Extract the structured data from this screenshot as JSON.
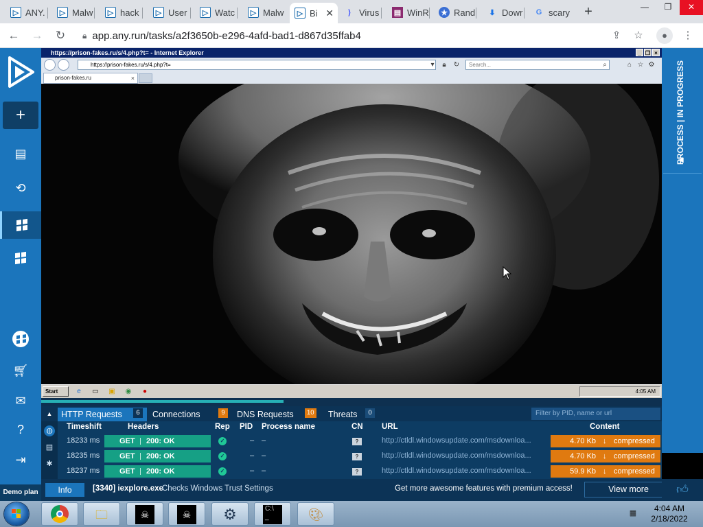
{
  "browser": {
    "tabs": [
      {
        "title": "ANY.",
        "icon": "anyrun-icon"
      },
      {
        "title": "Malw",
        "icon": "anyrun-icon"
      },
      {
        "title": "hack",
        "icon": "anyrun-icon"
      },
      {
        "title": "User",
        "icon": "anyrun-icon"
      },
      {
        "title": "Watc",
        "icon": "anyrun-icon"
      },
      {
        "title": "Malw",
        "icon": "anyrun-icon"
      },
      {
        "title": "Bi",
        "icon": "anyrun-icon",
        "close": "✕"
      },
      {
        "title": "Virus",
        "icon": "virustotal-icon"
      },
      {
        "title": "WinR",
        "icon": "winrar-icon"
      },
      {
        "title": "Rand",
        "icon": "random-icon"
      },
      {
        "title": "Dowr",
        "icon": "download-icon"
      },
      {
        "title": "scary",
        "icon": "google-icon"
      }
    ],
    "new_tab": "+",
    "address": "app.any.run/tasks/a2f3650b-e296-4afd-bad1-d867d35ffab4",
    "window_buttons": {
      "minimize": "—",
      "restore": "❐",
      "close": "✕"
    }
  },
  "sidebar": {
    "demo_label": "Demo plan"
  },
  "right_strip": {
    "status": "PROCESS | IN PROGRESS"
  },
  "vm": {
    "ie_title": "https://prison-fakes.ru/s/4.php?t= - Internet Explorer",
    "ie_address": "https://prison-fakes.ru/s/4.php?t=",
    "ie_search_placeholder": "Search...",
    "ie_tab": "prison-fakes.ru",
    "xp_start": "Start",
    "xp_clock": "4:05 AM"
  },
  "progress": {
    "value": 0.39
  },
  "panel": {
    "tabs": [
      {
        "label": "HTTP Requests",
        "count": "6"
      },
      {
        "label": "Connections",
        "count": "9"
      },
      {
        "label": "DNS Requests",
        "count": "10"
      },
      {
        "label": "Threats",
        "count": "0"
      }
    ],
    "filter_placeholder": "Filter by PID, name or url",
    "columns": {
      "timeshift": "Timeshift",
      "headers": "Headers",
      "rep": "Rep",
      "pid": "PID",
      "process": "Process name",
      "cn": "CN",
      "url": "URL",
      "content": "Content"
    },
    "rows": [
      {
        "time": "18233 ms",
        "method": "GET",
        "status": "200: OK",
        "pid": "–",
        "process": "–",
        "cn": "?",
        "url": "http://ctldl.windowsupdate.com/msdownloa...",
        "size": "4.70 Kb",
        "content": "compressed"
      },
      {
        "time": "18235 ms",
        "method": "GET",
        "status": "200: OK",
        "pid": "–",
        "process": "–",
        "cn": "?",
        "url": "http://ctldl.windowsupdate.com/msdownloa...",
        "size": "4.70 Kb",
        "content": "compressed"
      },
      {
        "time": "18237 ms",
        "method": "GET",
        "status": "200: OK",
        "pid": "–",
        "process": "–",
        "cn": "?",
        "url": "http://ctldl.windowsupdate.com/msdownloa...",
        "size": "59.9 Kb",
        "content": "compressed"
      }
    ]
  },
  "infobar": {
    "info_label": "Info",
    "process": "[3340] iexplore.exe",
    "description": "Checks Windows Trust Settings",
    "promo": "Get more awesome features with premium access!",
    "view_more": "View more"
  },
  "taskbar": {
    "time": "4:04 AM",
    "date": "2/18/2022"
  }
}
